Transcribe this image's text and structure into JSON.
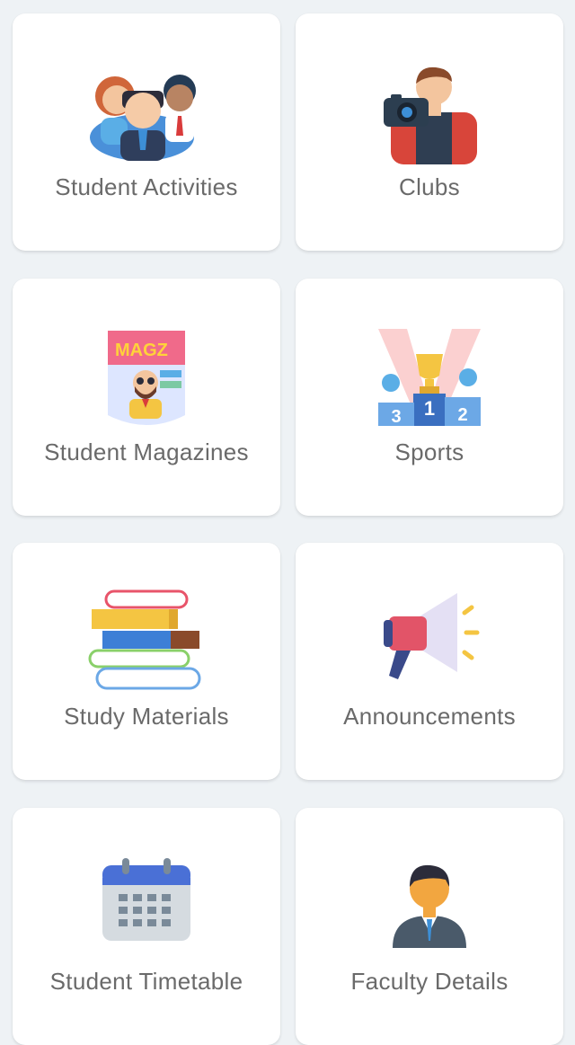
{
  "cards": [
    {
      "label": "Student Activities",
      "icon": "student-group-icon"
    },
    {
      "label": "Clubs",
      "icon": "photographer-icon"
    },
    {
      "label": "Student Magazines",
      "icon": "magazine-icon"
    },
    {
      "label": "Sports",
      "icon": "trophy-podium-icon"
    },
    {
      "label": "Study Materials",
      "icon": "books-stack-icon"
    },
    {
      "label": "Announcements",
      "icon": "megaphone-icon"
    },
    {
      "label": "Student Timetable",
      "icon": "calendar-icon"
    },
    {
      "label": "Faculty Details",
      "icon": "faculty-person-icon"
    }
  ],
  "magazine_title": "MAGZ",
  "podium_places": [
    "1",
    "2",
    "3"
  ]
}
